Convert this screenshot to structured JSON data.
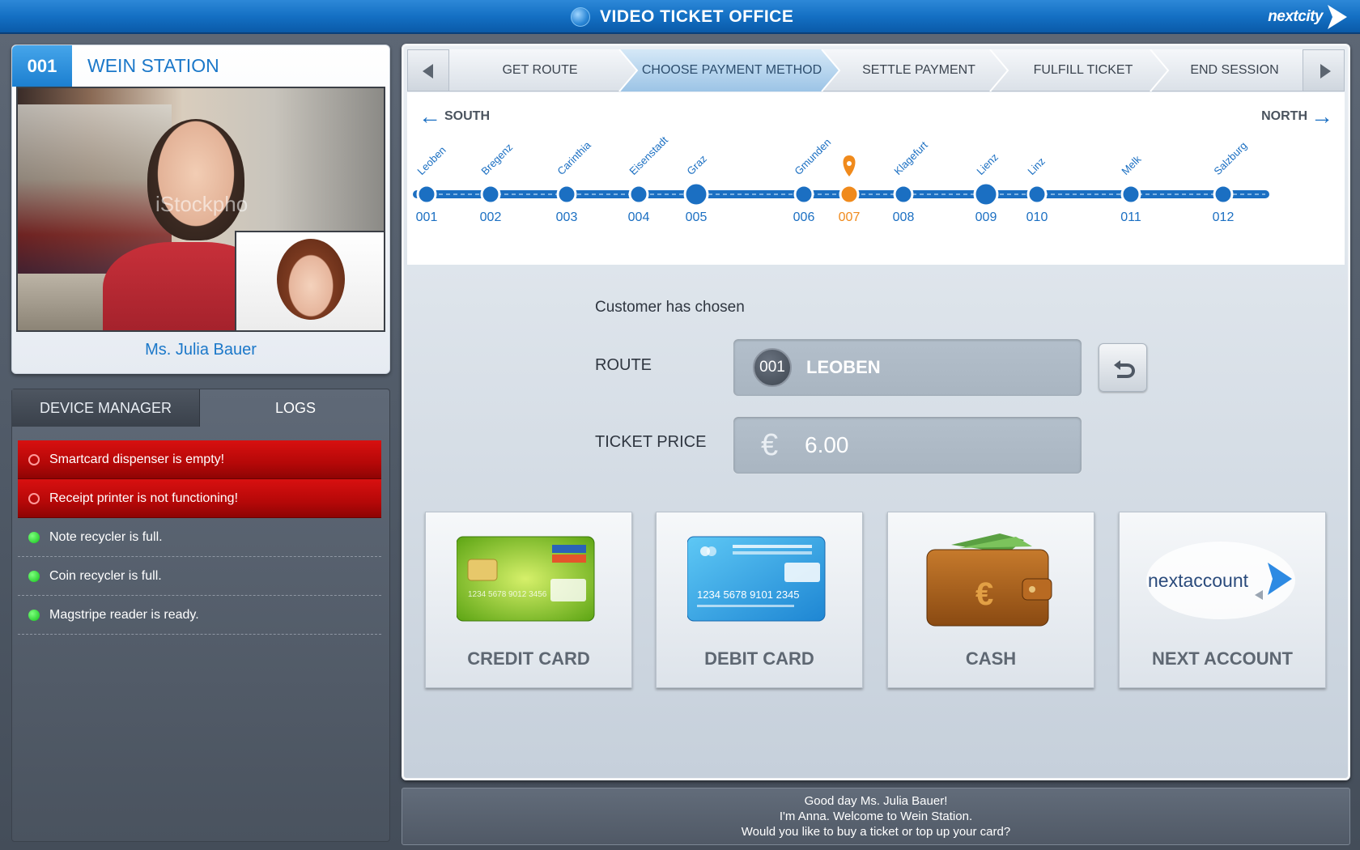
{
  "header": {
    "title": "VIDEO TICKET OFFICE",
    "brand": "nextcity"
  },
  "camera": {
    "station_number": "001",
    "station_name": "WEIN STATION",
    "operator_name": "Ms. Julia Bauer",
    "watermark": "iStockpho"
  },
  "device_manager": {
    "tabs": [
      {
        "label": "DEVICE MANAGER"
      },
      {
        "label": "LOGS"
      }
    ],
    "items": [
      {
        "text": "Smartcard dispenser is empty!",
        "status": "error"
      },
      {
        "text": "Receipt printer is not functioning!",
        "status": "error"
      },
      {
        "text": "Note recycler is full.",
        "status": "ok"
      },
      {
        "text": "Coin recycler is full.",
        "status": "ok"
      },
      {
        "text": "Magstripe reader is ready.",
        "status": "ok"
      }
    ]
  },
  "steps": [
    {
      "label": "GET ROUTE",
      "active": false
    },
    {
      "label": "CHOOSE PAYMENT METHOD",
      "active": true
    },
    {
      "label": "SETTLE PAYMENT",
      "active": false
    },
    {
      "label": "FULFILL TICKET",
      "active": false
    },
    {
      "label": "END SESSION",
      "active": false
    }
  ],
  "route_map": {
    "south_label": "SOUTH",
    "north_label": "NORTH",
    "current_stop": "007",
    "stops": [
      {
        "name": "Leoben",
        "number": "001"
      },
      {
        "name": "Bregenz",
        "number": "002"
      },
      {
        "name": "Carinthia",
        "number": "003"
      },
      {
        "name": "Eisenstadt",
        "number": "004"
      },
      {
        "name": "Graz",
        "number": "005"
      },
      {
        "name": "Gmunden",
        "number": "006"
      },
      {
        "name": "",
        "number": "007"
      },
      {
        "name": "Klagefurt",
        "number": "008"
      },
      {
        "name": "Lienz",
        "number": "009"
      },
      {
        "name": "Linz",
        "number": "010"
      },
      {
        "name": "Melk",
        "number": "011"
      },
      {
        "name": "Salzburg",
        "number": "012"
      }
    ]
  },
  "selection": {
    "chosen_label": "Customer has chosen",
    "route_label": "ROUTE",
    "route_number": "001",
    "route_name": "LEOBEN",
    "price_label": "TICKET PRICE",
    "currency_symbol": "€",
    "price": "6.00"
  },
  "payment_methods": [
    {
      "label": "CREDIT CARD",
      "card_number": "1234 5678 9012 3456"
    },
    {
      "label": "DEBIT CARD",
      "card_number": "1234 5678 9101 2345"
    },
    {
      "label": "CASH"
    },
    {
      "label": "NEXT ACCOUNT",
      "logo": "nextaccount"
    }
  ],
  "message": {
    "lines": [
      "Good day Ms. Julia Bauer!",
      "I'm Anna. Welcome to Wein Station.",
      "Would you like to buy a ticket or top up your card?"
    ]
  },
  "colors": {
    "accent": "#1b6fc2",
    "current_stop": "#f08a1c",
    "error": "#c80a0a",
    "ok": "#18c420"
  }
}
